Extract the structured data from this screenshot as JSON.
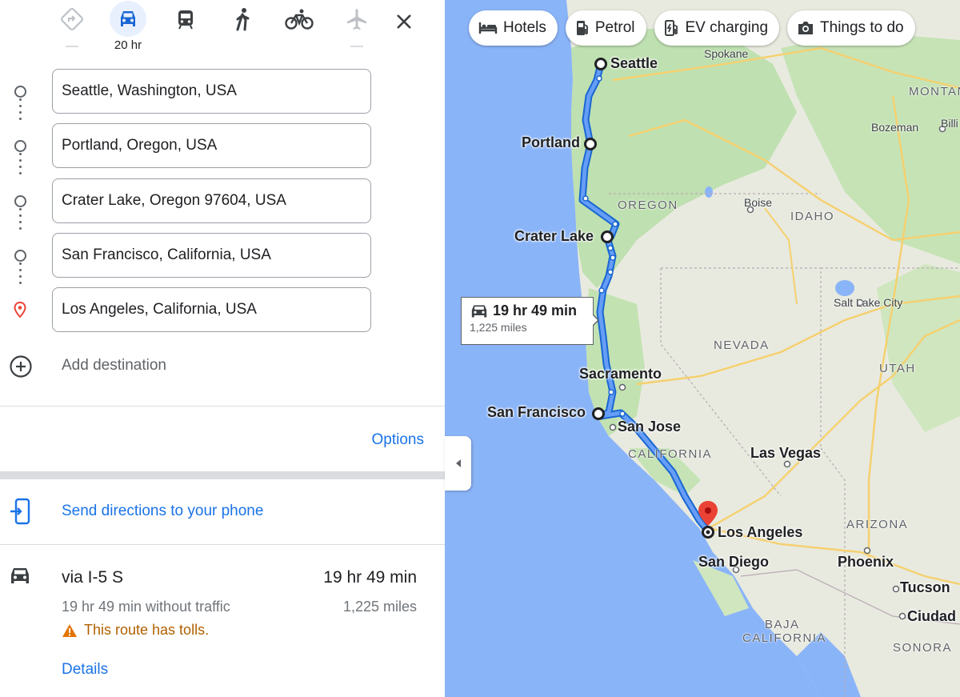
{
  "modes": [
    {
      "name": "best-mode",
      "label": ""
    },
    {
      "name": "driving",
      "label": "20 hr"
    },
    {
      "name": "transit",
      "label": ""
    },
    {
      "name": "walking",
      "label": ""
    },
    {
      "name": "cycling",
      "label": ""
    },
    {
      "name": "flights",
      "label": ""
    }
  ],
  "stops": [
    "Seattle, Washington, USA",
    "Portland, Oregon, USA",
    "Crater Lake, Oregon 97604, USA",
    "San Francisco, California, USA",
    "Los Angeles, California, USA"
  ],
  "add_destination": "Add destination",
  "options_label": "Options",
  "send_to_phone": "Send directions to your phone",
  "route": {
    "via": "via I-5 S",
    "duration": "19 hr 49 min",
    "without_traffic": "19 hr 49 min without traffic",
    "distance": "1,225 miles",
    "warning": "This route has tolls.",
    "details_label": "Details"
  },
  "map": {
    "chips": [
      "Hotels",
      "Petrol",
      "EV charging",
      "Things to do"
    ],
    "route_box": {
      "duration": "19 hr 49 min",
      "distance": "1,225 miles"
    },
    "cities": {
      "seattle": "Seattle",
      "portland": "Portland",
      "crater_lake": "Crater Lake",
      "sacramento": "Sacramento",
      "san_francisco": "San Francisco",
      "san_jose": "San Jose",
      "las_vegas": "Las Vegas",
      "los_angeles": "Los Angeles",
      "san_diego": "San Diego",
      "phoenix": "Phoenix",
      "tucson": "Tucson",
      "ciudad": "Ciudad",
      "salt_lake_city": "Salt Lake City",
      "boise": "Boise",
      "spokane": "Spokane",
      "bozeman": "Bozeman",
      "billings": "Billi"
    },
    "states": {
      "oregon": "OREGON",
      "idaho": "IDAHO",
      "nevada": "NEVADA",
      "utah": "UTAH",
      "california": "CALIFORNIA",
      "arizona": "ARIZONA",
      "montana": "MONTAN",
      "baja": "BAJA",
      "baja_california": "CALIFORNIA",
      "sonora": "SONORA"
    }
  },
  "colors": {
    "route": "#1a73e8",
    "accent": "#1a73e8",
    "warning": "#b06000",
    "destination_pin": "#ea4335"
  }
}
